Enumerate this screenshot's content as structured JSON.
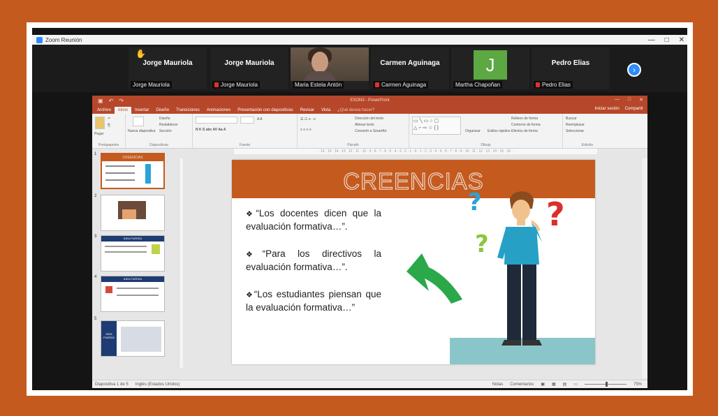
{
  "zoom": {
    "window_title": "Zoom Reunión",
    "participants": [
      {
        "display_name": "Jorge Mauriola",
        "label": "Jorge Mauriola"
      },
      {
        "display_name": "Jorge Mauriola",
        "label": "Jorge Mauriola"
      },
      {
        "display_name": "",
        "label": "Maria Estela Antón"
      },
      {
        "display_name": "Carmen Aguinaga",
        "label": "Carmen Aguinaga"
      },
      {
        "display_name": "J",
        "label": "Martha Chapoñan"
      },
      {
        "display_name": "Pedro Elias",
        "label": "Pedro Elias"
      }
    ],
    "controls": {
      "minimize": "—",
      "maximize": "□",
      "close": "✕"
    },
    "next_page": "›"
  },
  "ppt": {
    "title": "ESON3 - PowerPoint",
    "tabs": [
      "Archivo",
      "Inicio",
      "Insertar",
      "Diseño",
      "Transiciones",
      "Animaciones",
      "Presentación con diapositivas",
      "Revisar",
      "Vista",
      "¿Qué desea hacer?"
    ],
    "tabs_right": [
      "Iniciar sesión",
      "Compartir"
    ],
    "ribbon_groups": [
      "Portapapeles",
      "Diapositivas",
      "Fuente",
      "Párrafo",
      "Dibujo",
      "Edición"
    ],
    "ribbon_labels": {
      "paste": "Pegar",
      "new_slide": "Nueva diapositiva",
      "design": "Diseño",
      "reset": "Restablecer",
      "section": "Sección",
      "text_direction": "Dirección del texto",
      "align_text": "Alinear texto",
      "convert_smartart": "Convertir a SmartArt",
      "arrange": "Organizar",
      "quick_styles": "Estilos rápidos",
      "fill": "Relleno de forma",
      "outline": "Contorno de forma",
      "effects": "Efectos de forma",
      "find": "Buscar",
      "replace": "Reemplazar",
      "select": "Seleccionar"
    },
    "slide_numbers": [
      "1",
      "2",
      "3",
      "4",
      "5"
    ],
    "thumb_texts": [
      "CREENCIAS",
      "",
      "IDEA FUERZA",
      "IDEA FUERZA",
      "IDEA FUERZA"
    ],
    "slide": {
      "title": "CREENCIAS",
      "bullet_mark": "❖",
      "bullets": [
        "“Los docentes dicen que la evaluación formativa…”.",
        "“Para los directivos la evaluación formativa…”.",
        "“Los estudiantes piensan que la evaluación formativa…”"
      ]
    },
    "status": {
      "slide_info": "Diapositiva 1 de 5",
      "language": "Inglés (Estados Unidos)",
      "notes": "Notas",
      "comments": "Comentarios",
      "zoom": "75%"
    },
    "colors": {
      "accent": "#c55a1e",
      "ppt_red": "#b7472a",
      "teal_floor": "#8ac6c9",
      "question_blue": "#2aa3d8",
      "question_red": "#d9312a",
      "question_green": "#8cc63f",
      "arrow_green": "#2aa84a"
    }
  }
}
